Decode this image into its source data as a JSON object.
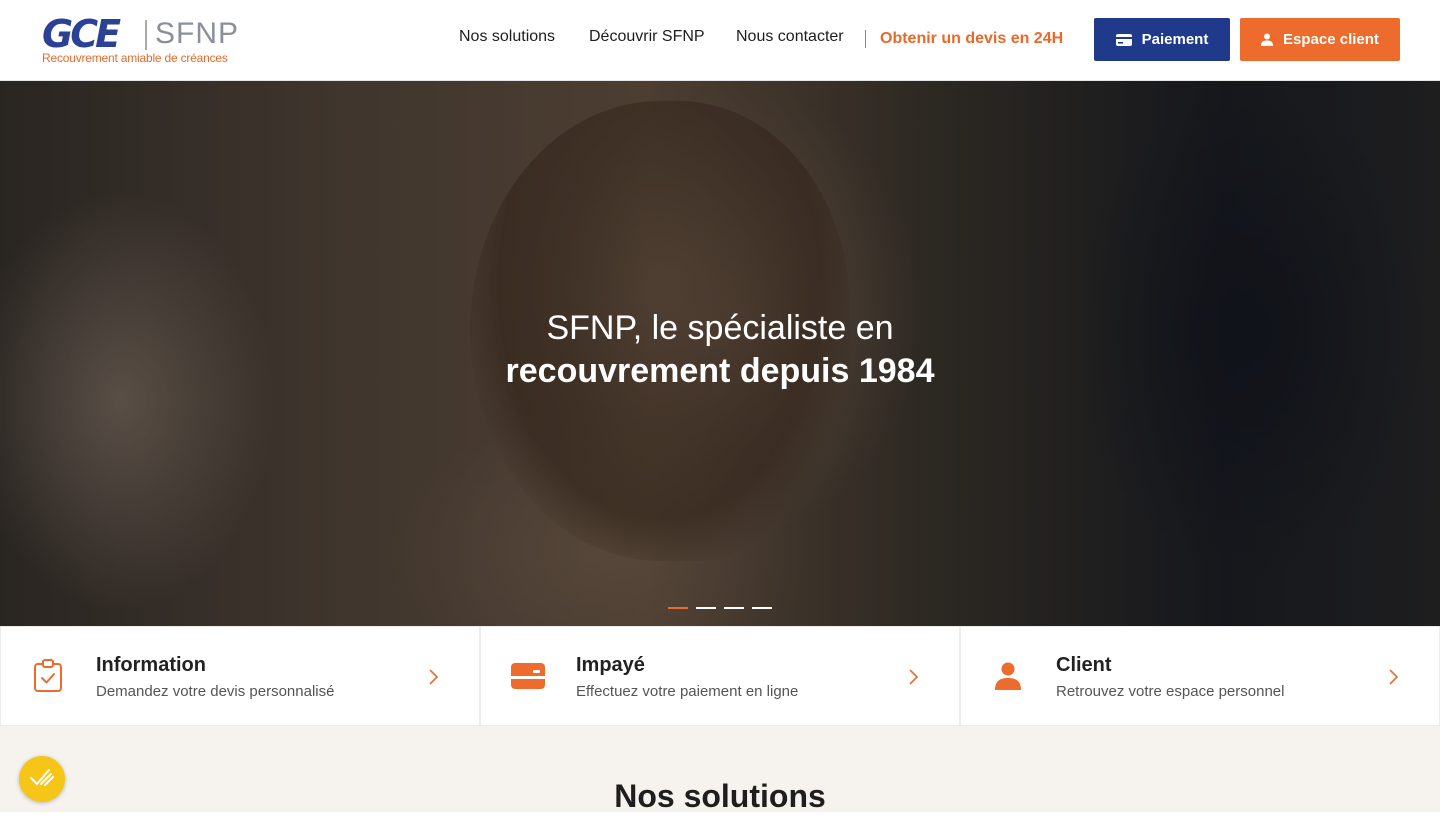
{
  "logo": {
    "mark": "GCE",
    "name": "SFNP",
    "tagline": "Recouvrement amiable de créances"
  },
  "nav": {
    "links": [
      "Nos solutions",
      "Découvrir SFNP",
      "Nous contacter"
    ],
    "devis": "Obtenir un devis en 24H",
    "pay_button": "Paiement",
    "client_button": "Espace client"
  },
  "hero": {
    "line1": "SFNP, le spécialiste en",
    "line2": "recouvrement depuis 1984",
    "slides": 4,
    "active_slide": 1
  },
  "cards": [
    {
      "title": "Information",
      "subtitle": "Demandez votre devis personnalisé",
      "icon": "clipboard-check-icon"
    },
    {
      "title": "Impayé",
      "subtitle": "Effectuez votre paiement en ligne",
      "icon": "credit-card-icon"
    },
    {
      "title": "Client",
      "subtitle": "Retrouvez votre espace personnel",
      "icon": "user-icon"
    }
  ],
  "solutions": {
    "title": "Nos solutions"
  },
  "colors": {
    "brand_blue": "#1f3a8a",
    "brand_orange": "#ec6b2d",
    "cookie_yellow": "#f5c518"
  }
}
